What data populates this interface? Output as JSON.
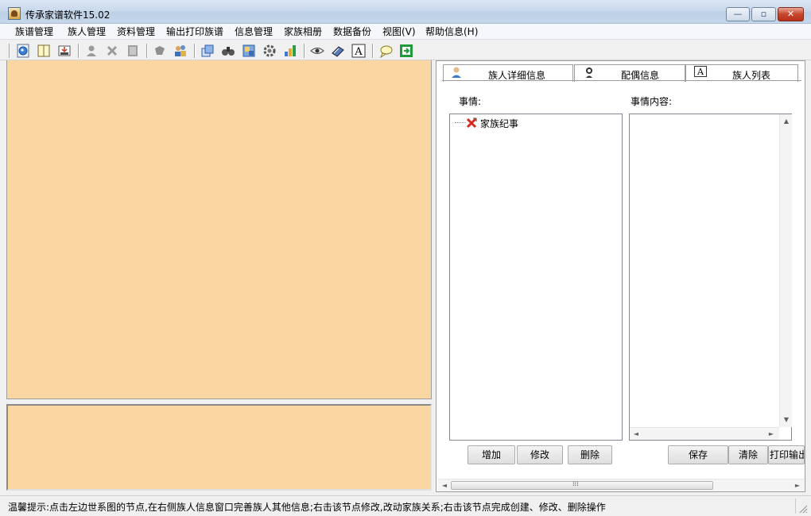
{
  "window": {
    "title": "传承家谱软件15.02"
  },
  "window_controls": {
    "minimize": "—",
    "maximize": "▫",
    "close": "✕"
  },
  "menu": [
    "族谱管理",
    "族人管理",
    "资料管理",
    "输出打印族谱",
    "信息管理",
    "家族相册",
    "数据备份",
    "视图(V)",
    "帮助信息(H)"
  ],
  "toolbar": {
    "icons": [
      "globe-icon",
      "book-icon",
      "book-export-icon",
      "person-icon",
      "delete-x-icon",
      "grid-icon",
      "puzzle-icon",
      "people-icon",
      "copy-windows-icon",
      "binoculars-icon",
      "image-icon",
      "gear-icon",
      "bar-chart-icon",
      "eye-icon",
      "books-icon",
      "text-a-icon",
      "chat-bubble-icon",
      "exit-icon"
    ]
  },
  "tabs": [
    {
      "label": "族人详细信息",
      "icon": "person-icon"
    },
    {
      "label": "配偶信息",
      "icon": "spouse-icon"
    },
    {
      "label": "族人列表",
      "icon": "text-a-icon"
    }
  ],
  "events": {
    "label": "事情:",
    "items": [
      {
        "label": "家族纪事",
        "icon": "red-x-icon"
      }
    ]
  },
  "content": {
    "label": "事情内容:"
  },
  "buttons": {
    "add": "增加",
    "edit": "修改",
    "delete": "删除",
    "save": "保存",
    "clear": "清除",
    "print": "打印输出"
  },
  "scroll_glyphs": {
    "up": "▲",
    "down": "▼",
    "left": "◄",
    "right": "►",
    "grip": "⁞⁞⁞"
  },
  "status": {
    "text": "温馨提示:点击左边世系图的节点,在右侧族人信息窗口完善族人其他信息;右击该节点修改,改动家族关系;右击该节点完成创建、修改、删除操作"
  }
}
